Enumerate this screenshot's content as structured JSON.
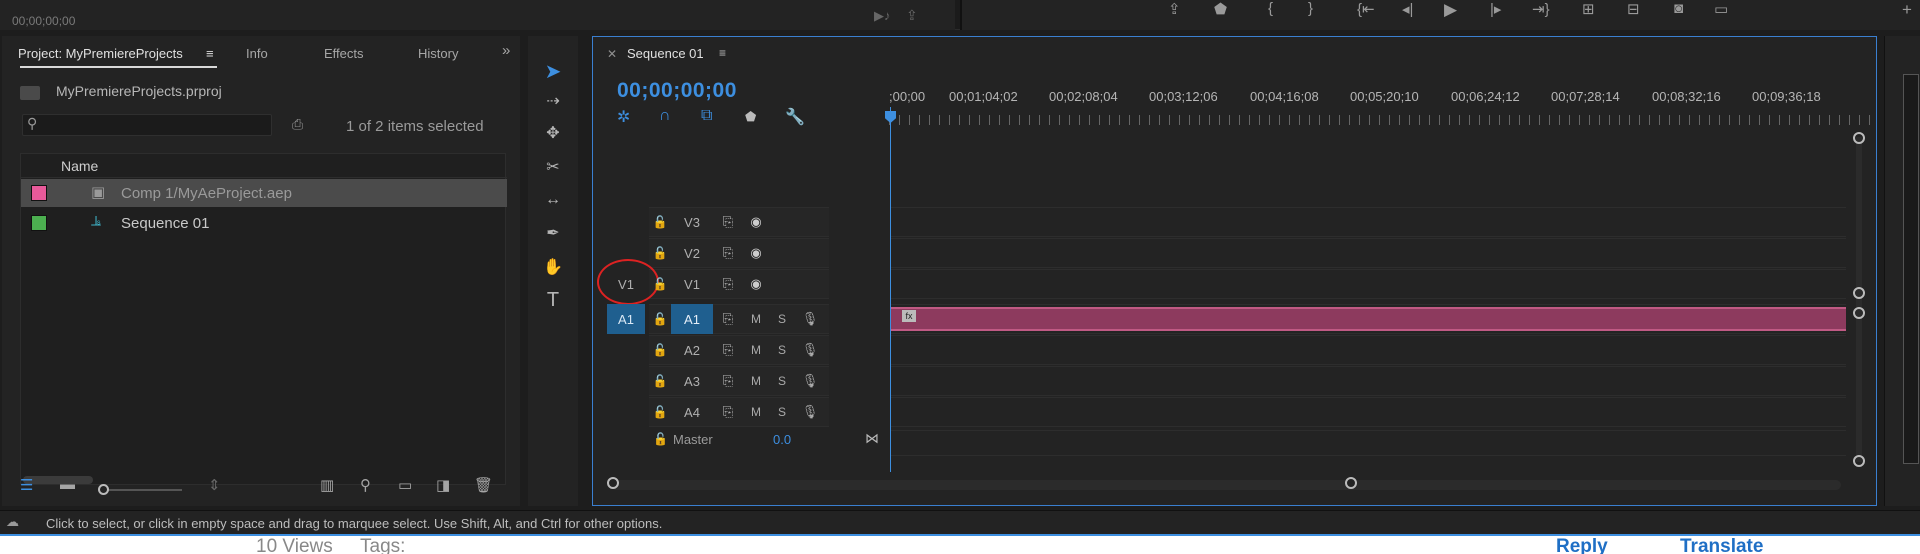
{
  "top": {
    "timecode": "00;00;00;00",
    "transport_icons": [
      "export-frame-icon",
      "marker-icon",
      "mark-in-icon",
      "mark-out-icon",
      "go-to-in-icon",
      "step-back-icon",
      "play-icon",
      "step-forward-icon",
      "go-to-out-icon",
      "lift-icon",
      "extract-icon",
      "camera-icon",
      "compare-icon"
    ]
  },
  "project_panel": {
    "tabs": [
      {
        "label": "Project: MyPremiereProjects",
        "active": true
      },
      {
        "label": "Info"
      },
      {
        "label": "Effects"
      },
      {
        "label": "History"
      }
    ],
    "overflow": "»",
    "project_file": "MyPremiereProjects.prproj",
    "search_placeholder": "",
    "selection_status": "1 of 2 items selected",
    "column_name": "Name",
    "items": [
      {
        "label": "Comp 1/MyAeProject.aep",
        "color": "#e85a9a",
        "icon": "ae-comp-icon",
        "selected": true
      },
      {
        "label": "Sequence 01",
        "color": "#4caf50",
        "icon": "sequence-icon",
        "selected": false
      }
    ]
  },
  "timeline": {
    "tab_title": "Sequence 01",
    "timecode": "00;00;00;00",
    "ruler_labels": [
      ";00;00",
      "00;01;04;02",
      "00;02;08;04",
      "00;03;12;06",
      "00;04;16;08",
      "00;05;20;10",
      "00;06;24;12",
      "00;07;28;14",
      "00;08;32;16",
      "00;09;36;18"
    ],
    "video_tracks": [
      {
        "name": "V3",
        "source": ""
      },
      {
        "name": "V2",
        "source": ""
      },
      {
        "name": "V1",
        "source": "V1"
      }
    ],
    "audio_tracks": [
      {
        "name": "A1",
        "source": "A1",
        "m": "M",
        "s": "S"
      },
      {
        "name": "A2",
        "source": "",
        "m": "M",
        "s": "S"
      },
      {
        "name": "A3",
        "source": "",
        "m": "M",
        "s": "S"
      },
      {
        "name": "A4",
        "source": "",
        "m": "M",
        "s": "S"
      }
    ],
    "clip_fx": "fx",
    "master_label": "Master",
    "master_value": "0.0",
    "clip_color": "#8d3a5e"
  },
  "status_bar": {
    "text": "Click to select, or click in empty space and drag to marquee select. Use Shift, Alt, and Ctrl for other options."
  },
  "web": {
    "views": "10 Views",
    "tags": "Tags:",
    "reply": "Reply",
    "translate": "Translate"
  }
}
